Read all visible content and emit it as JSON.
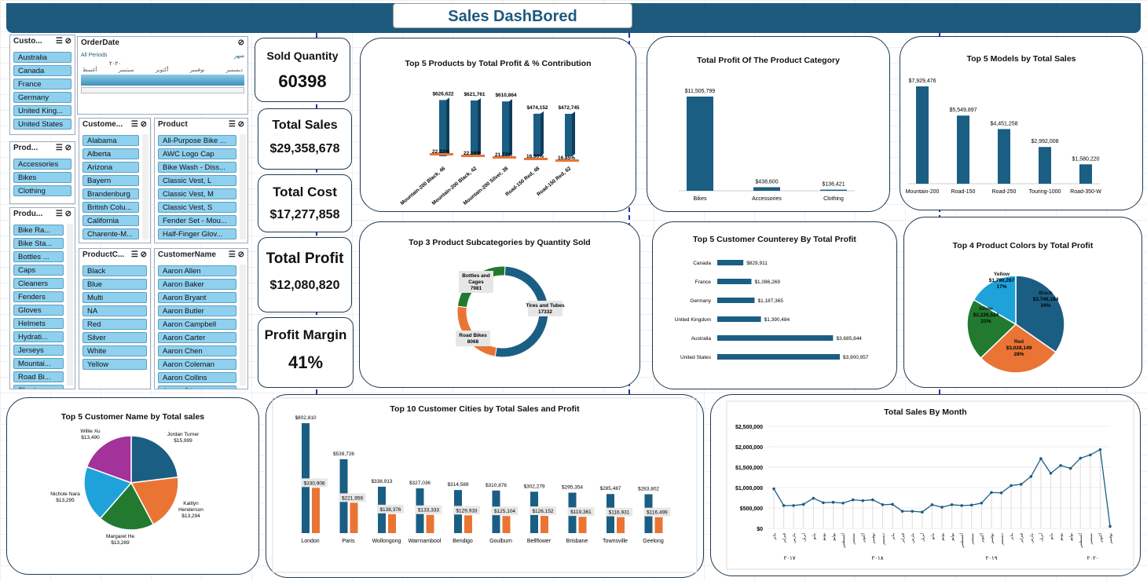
{
  "title": "Sales DashBored",
  "kpis": [
    {
      "label": "Sold Quantity",
      "value": "60398"
    },
    {
      "label": "Total Sales",
      "value": "$29,358,678"
    },
    {
      "label": "Total Cost",
      "value": "$17,277,858"
    },
    {
      "label": "Total Profit",
      "value": "$12,080,820"
    },
    {
      "label": "Profit Margin",
      "value": "41%"
    }
  ],
  "slicers": {
    "customer_country": {
      "title": "Custo...",
      "items": [
        "Australia",
        "Canada",
        "France",
        "Germany",
        "United King...",
        "United States"
      ]
    },
    "order_date": {
      "title": "OrderDate",
      "all_periods": "All Periods",
      "level": "شهر",
      "year": "٢٠٢٠",
      "months": [
        "أغسط",
        "سبتمبر",
        "أكتوبر",
        "نوفمبر",
        "ديسمبر"
      ]
    },
    "product_category": {
      "title": "Prod...",
      "items": [
        "Accessories",
        "Bikes",
        "Clothing"
      ]
    },
    "product_subcategory": {
      "title": "Produ...",
      "items": [
        "Bike Ra...",
        "Bike Sta...",
        "Bottles ...",
        "Caps",
        "Cleaners",
        "Fenders",
        "Gloves",
        "Helmets",
        "Hydrati...",
        "Jerseys",
        "Mountai...",
        "Road Bi...",
        "Shorts"
      ]
    },
    "customer_state": {
      "title": "Custome...",
      "items": [
        "Alabama",
        "Alberta",
        "Arizona",
        "Bayern",
        "Brandenburg",
        "British Colu...",
        "California",
        "Charente-M..."
      ]
    },
    "product": {
      "title": "Product",
      "items": [
        "All-Purpose Bike ...",
        "AWC Logo Cap",
        "Bike Wash - Diss...",
        "Classic Vest, L",
        "Classic Vest, M",
        "Classic Vest, S",
        "Fender Set - Mou...",
        "Half-Finger Glov..."
      ]
    },
    "product_color": {
      "title": "ProductC...",
      "items": [
        "Black",
        "Blue",
        "Multi",
        "NA",
        "Red",
        "Silver",
        "White",
        "Yellow"
      ]
    },
    "customer_name": {
      "title": "CustomerName",
      "items": [
        "Aaron Allen",
        "Aaron Baker",
        "Aaron Bryant",
        "Aaron Butler",
        "Aaron Campbell",
        "Aaron Carter",
        "Aaron Chen",
        "Aaron Coleman",
        "Aaron Collins",
        "Aaron Diaz"
      ]
    }
  },
  "colors": {
    "primary": "#1b5e84",
    "orange": "#ea7434",
    "green": "#217a2f",
    "blue": "#1fa2da",
    "purple": "#a4329b",
    "accent": "#1d5a7e"
  },
  "chart_data": [
    {
      "id": "top5products",
      "type": "bar",
      "title": "Top 5 Products by Total Profit & % Contribution",
      "categories": [
        "Mountain-200 Black, 46",
        "Mountain-200 Black, 42",
        "Mountain-200 Silver, 38",
        "Road-150 Red, 48",
        "Road-150 Red, 62"
      ],
      "series": [
        {
          "values": [
            626622,
            621761,
            610864,
            474152,
            472745
          ]
        }
      ],
      "value_labels": [
        "$626,622",
        "$621,761",
        "$610,864",
        "$474,152",
        "$472,745"
      ],
      "pct_labels": [
        "22.33%",
        "22.16%",
        "21.77%",
        "16.90%",
        "16.85%"
      ]
    },
    {
      "id": "category",
      "type": "bar",
      "title": "Total Profit Of The Product Category",
      "categories": [
        "Bikes",
        "Accessories",
        "Clothing"
      ],
      "series": [
        {
          "values": [
            11505799,
            438600,
            136421
          ]
        }
      ],
      "value_labels": [
        "$11,505,799",
        "$438,600",
        "$136,421"
      ]
    },
    {
      "id": "models",
      "type": "bar",
      "title": "Top 5 Models by Total Sales",
      "categories": [
        "Mountain-200",
        "Road-150",
        "Road-250",
        "Touring-1000",
        "Road-350-W"
      ],
      "series": [
        {
          "values": [
            7929476,
            5549897,
            4451258,
            2992008,
            1580220
          ]
        }
      ],
      "value_labels": [
        "$7,929,476",
        "$5,549,897",
        "$4,451,258",
        "$2,992,008",
        "$1,580,220"
      ]
    },
    {
      "id": "subcats",
      "type": "pie",
      "title": "Top 3 Product Subcategories by Quantity Sold",
      "categories": [
        "Tires and Tubes",
        "Road Bikes",
        "Bottles and Cages"
      ],
      "series": [
        {
          "values": [
            17332,
            8068,
            7981
          ]
        }
      ]
    },
    {
      "id": "countries",
      "type": "bar",
      "title": "Top 5 Customer Counterey By Total Profit",
      "categories": [
        "Canada",
        "France",
        "Germany",
        "United Kingdom",
        "Australia",
        "United States"
      ],
      "series": [
        {
          "values": [
            829911,
            1086269,
            1187365,
            1390484,
            3685844,
            3900957
          ]
        }
      ],
      "value_labels": [
        "$829,911",
        "$1,086,269",
        "$1,187,365",
        "$1,390,484",
        "$3,685,844",
        "$3,900,957"
      ]
    },
    {
      "id": "colors",
      "type": "pie",
      "title": "Top 4 Product Colors by Total Profit",
      "categories": [
        "Black",
        "Red",
        "Silver",
        "Yellow"
      ],
      "series": [
        {
          "values": [
            3746184,
            3028149,
            2226524,
            1790287
          ]
        }
      ],
      "value_labels": [
        "$3,746,184",
        "$3,028,149",
        "$2,226,524",
        "$1,790,287"
      ],
      "pct_labels": [
        "34%",
        "28%",
        "21%",
        "17%"
      ]
    },
    {
      "id": "customers",
      "type": "pie",
      "title": "Top 5 Customer Name by Total sales",
      "categories": [
        "Jordan Turner",
        "Kaitlyn Henderson",
        "Margaret He",
        "Nichole Nara",
        "Willie Xu"
      ],
      "series": [
        {
          "values": [
            15999,
            13294,
            13269,
            13295,
            13490
          ]
        }
      ],
      "value_labels": [
        "$15,999",
        "$13,294",
        "$13,269",
        "$13,295",
        "$13,490"
      ]
    },
    {
      "id": "cities",
      "type": "bar",
      "title": "Top 10 Customer Cities by Total Sales and Profit",
      "categories": [
        "London",
        "Paris",
        "Wollongong",
        "Warrnambool",
        "Bendigo",
        "Goulburn",
        "Bellflower",
        "Brisbane",
        "Townsville",
        "Geelong"
      ],
      "series": [
        {
          "name": "Sales",
          "values": [
            802810,
            539726,
            338913,
            327036,
            314569,
            310876,
            302279,
            295354,
            285487,
            283802
          ]
        },
        {
          "name": "Profit",
          "values": [
            330908,
            221959,
            138376,
            133333,
            129933,
            125104,
            126152,
            119361,
            116931,
            116499
          ]
        }
      ],
      "sales_labels": [
        "$802,810",
        "$539,726",
        "$338,913",
        "$327,036",
        "$314,569",
        "$310,876",
        "$302,279",
        "$295,354",
        "$285,487",
        "$283,802"
      ],
      "profit_labels": [
        "$330,908",
        "$221,959",
        "$138,376",
        "$133,333",
        "$129,933",
        "$125,104",
        "$126,152",
        "$119,361",
        "$116,931",
        "$116,499"
      ]
    },
    {
      "id": "monthly",
      "type": "line",
      "title": "Total Sales By Month",
      "ylim": [
        0,
        2500000
      ],
      "yticks": [
        "$0",
        "$500,000",
        "$1,000,000",
        "$1,500,000",
        "$2,000,000",
        "$2,500,000"
      ],
      "years": [
        "٢٠١٧",
        "٢٠١٨",
        "٢٠١٩",
        "٢٠٢٠"
      ],
      "months": [
        "يوليو",
        "أغسطس",
        "سبتمبر",
        "أكتوبر",
        "نوفمبر",
        "ديسمبر",
        "يناير",
        "فبراير",
        "مارس",
        "أبريل",
        "مايو",
        "يونيو"
      ],
      "values": [
        970000,
        560000,
        560000,
        590000,
        740000,
        630000,
        640000,
        620000,
        700000,
        680000,
        700000,
        580000,
        590000,
        420000,
        420000,
        400000,
        580000,
        520000,
        580000,
        560000,
        570000,
        620000,
        880000,
        870000,
        1050000,
        1080000,
        1270000,
        1710000,
        1350000,
        1540000,
        1470000,
        1720000,
        1800000,
        1930000,
        50000
      ]
    }
  ]
}
